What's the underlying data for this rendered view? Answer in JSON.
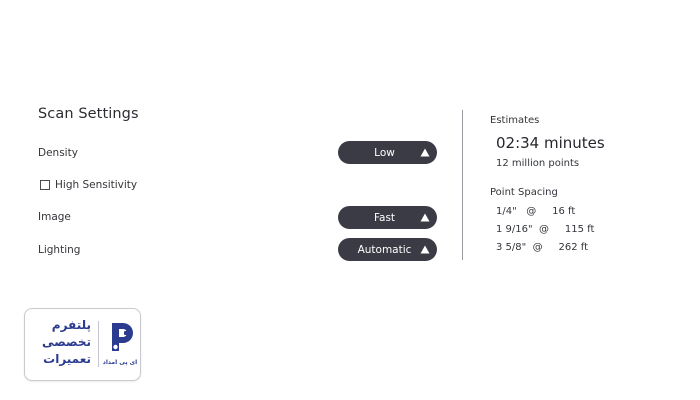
{
  "scan_settings": {
    "title": "Scan Settings",
    "density": {
      "label": "Density",
      "value": "Low"
    },
    "high_sensitivity": {
      "label": "High Sensitivity",
      "checked": false
    },
    "image": {
      "label": "Image",
      "value": "Fast"
    },
    "lighting": {
      "label": "Lighting",
      "value": "Automatic"
    }
  },
  "estimates": {
    "title": "Estimates",
    "time": "02:34 minutes",
    "points": "12  million points",
    "point_spacing": {
      "title": "Point Spacing",
      "rows": [
        "1/4\"   @     16 ft",
        "1 9/16\"  @     115 ft",
        "3 5/8\"  @     262 ft"
      ]
    }
  },
  "watermark": {
    "line1": "پلتفرم",
    "line2": "تخصصی",
    "line3": "تعمیرات",
    "brand": "ای پی امداد"
  },
  "colors": {
    "dropdown_bg": "#3a3b45",
    "dropdown_text": "#ffffff",
    "brand_blue": "#2b3b8f"
  },
  "icons": {
    "dropdown_arrow": "triangle-up-icon",
    "logo": "brand-logo-icon"
  }
}
